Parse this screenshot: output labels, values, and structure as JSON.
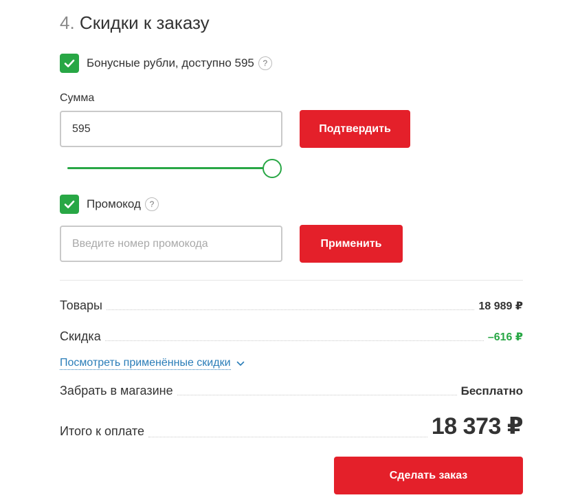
{
  "section": {
    "number": "4.",
    "title": "Скидки к заказу"
  },
  "bonus": {
    "checked": true,
    "label": "Бонусные рубли, доступно 595",
    "help": "?",
    "amount_label": "Сумма",
    "amount_value": "595",
    "confirm_button": "Подтвердить",
    "slider_level": 1.0
  },
  "promo": {
    "checked": true,
    "label": "Промокод",
    "help": "?",
    "placeholder": "Введите номер промокода",
    "apply_button": "Применить"
  },
  "summary": {
    "goods_label": "Товары",
    "goods_value": "18 989 ₽",
    "discount_label": "Скидка",
    "discount_value": "–616 ₽",
    "view_discounts_link": "Посмотреть применённые скидки",
    "pickup_label": "Забрать в магазине",
    "pickup_value": "Бесплатно",
    "total_label": "Итого к оплате",
    "total_value": "18 373 ₽"
  },
  "order_button": "Сделать заказ",
  "colors": {
    "accent_red": "#e4202a",
    "accent_green": "#28a745",
    "link_blue": "#2a7db8"
  }
}
